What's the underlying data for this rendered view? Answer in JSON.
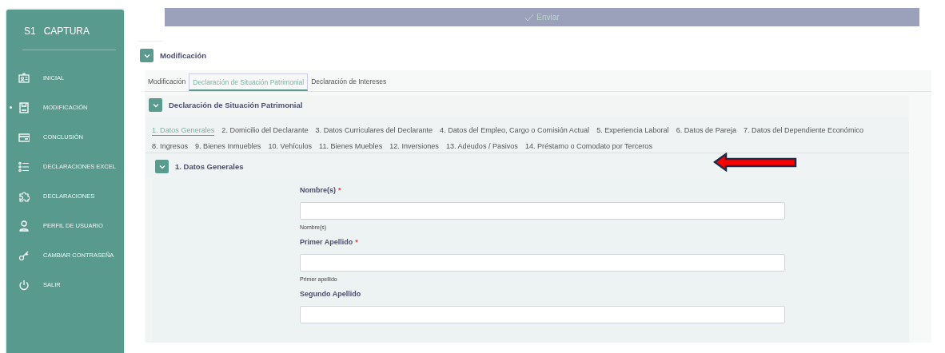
{
  "sidebar": {
    "code": "S1",
    "title": "CAPTURA",
    "items": [
      {
        "kind": "id-card",
        "label": "INICIAL",
        "selected": false
      },
      {
        "kind": "floppy",
        "label": "MODIFICACIÓN",
        "selected": true
      },
      {
        "kind": "card",
        "label": "CONCLUSIÓN",
        "selected": false
      },
      {
        "kind": "list",
        "label": "DECLARACIONES EXCEL",
        "selected": false
      },
      {
        "kind": "puzzle",
        "label": "DECLARACIONES",
        "selected": false
      },
      {
        "kind": "user",
        "label": "PERFIL DE USUARIO",
        "selected": false
      },
      {
        "kind": "key",
        "label": "CAMBIAR CONTRASEÑA",
        "selected": false
      },
      {
        "kind": "power",
        "label": "SALIR",
        "selected": false
      }
    ]
  },
  "send_button": {
    "label": "Enviar",
    "disabled": true
  },
  "panel": {
    "title": "Modificación",
    "expanded": true,
    "tabs": [
      {
        "label": "Modificación",
        "selected": false
      },
      {
        "label": "Declaración de Situación Patrimonial",
        "selected": true
      },
      {
        "label": "Declaración de Intereses",
        "selected": false
      }
    ],
    "subpanel": {
      "title": "Declaración de Situación Patrimonial",
      "expanded": true,
      "steps": [
        {
          "label": "1. Datos Generales",
          "selected": true
        },
        {
          "label": "2. Domicilio del Declarante",
          "selected": false
        },
        {
          "label": "3. Datos Curriculares del Declarante",
          "selected": false
        },
        {
          "label": "4. Datos del Empleo, Cargo o Comisión Actual",
          "selected": false
        },
        {
          "label": "5. Experiencia Laboral",
          "selected": false
        },
        {
          "label": "6. Datos de Pareja",
          "selected": false
        },
        {
          "label": "7. Datos del Dependiente Económico",
          "selected": false
        },
        {
          "label": "8. Ingresos",
          "selected": false
        },
        {
          "label": "9. Bienes Inmuebles",
          "selected": false
        },
        {
          "label": "10. Vehículos",
          "selected": false
        },
        {
          "label": "11. Bienes Muebles",
          "selected": false
        },
        {
          "label": "12. Inversiones",
          "selected": false
        },
        {
          "label": "13. Adeudos / Pasivos",
          "selected": false
        },
        {
          "label": "14. Préstamo o Comodato por Terceros",
          "selected": false
        }
      ],
      "section": {
        "title": "1. Datos Generales",
        "expanded": true,
        "fields": [
          {
            "label": "Nombre(s)",
            "required_mark": "*",
            "hint": "Nombre(s)"
          },
          {
            "label": "Primer Apellido",
            "required_mark": "*",
            "hint": "Primer apellido"
          },
          {
            "label": "Segundo Apellido"
          }
        ]
      }
    }
  }
}
